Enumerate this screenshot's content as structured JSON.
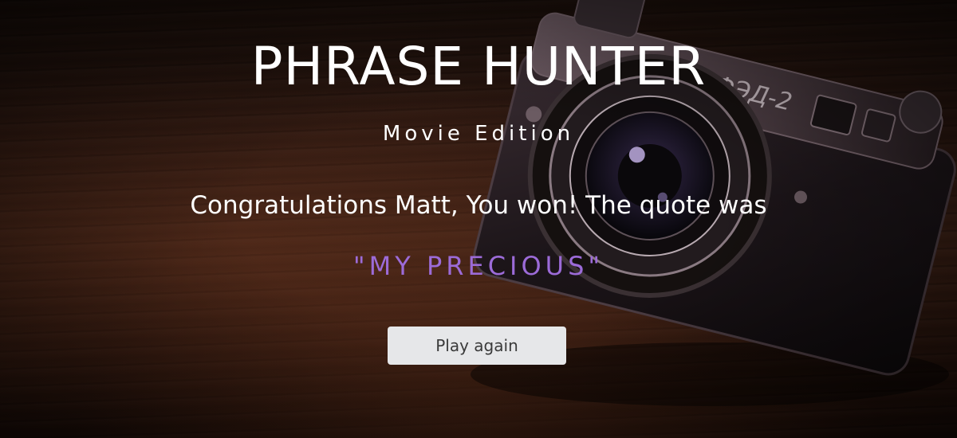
{
  "header": {
    "title": "PHRASE HUNTER",
    "subtitle": "Movie Edition"
  },
  "result": {
    "message": "Congratulations Matt, You won! The quote was",
    "quote": "\"MY PRECIOUS\""
  },
  "actions": {
    "play_again_label": "Play again"
  },
  "background": {
    "image": "camera-on-wooden-table",
    "camera_brand_text": "ФЭД-2"
  },
  "colors": {
    "quote": "#9c6bd8",
    "button_bg": "#e6e7e9",
    "button_text": "#3a3a3a",
    "text": "#ffffff"
  }
}
